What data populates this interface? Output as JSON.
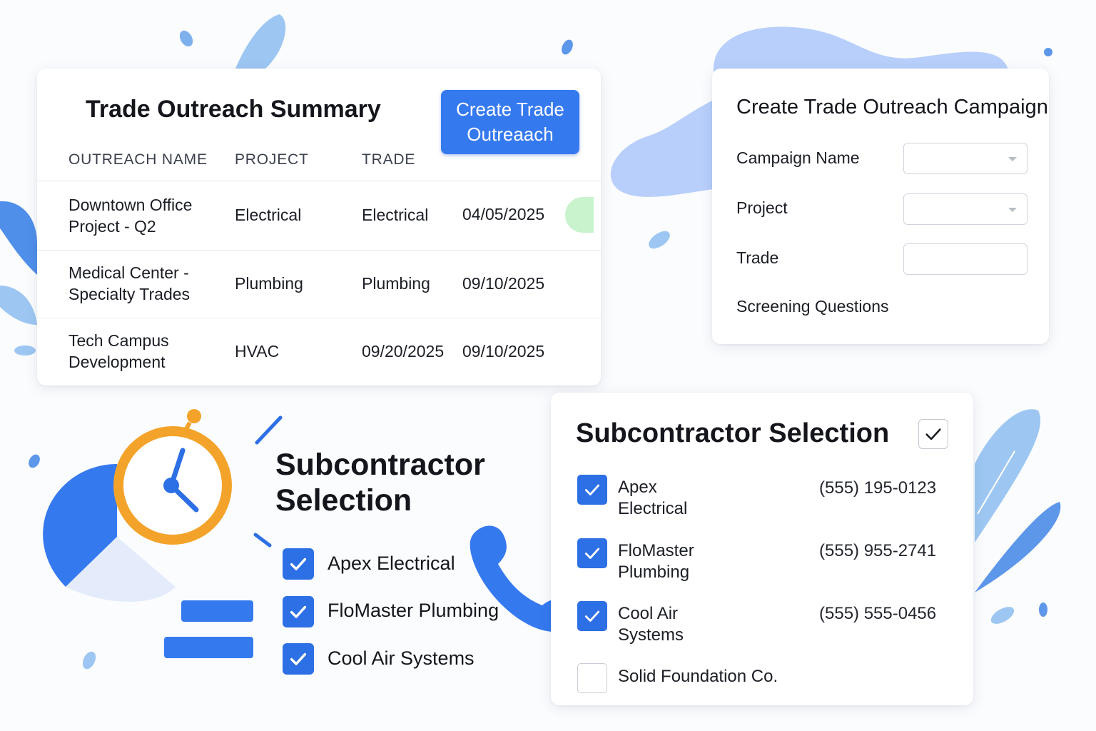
{
  "summary": {
    "title": "Trade Outreach Summary",
    "create_button": "Create Trade Outreaach",
    "columns": [
      "OUTREACH NAME",
      "PROJECT",
      "TRADE"
    ],
    "rows": [
      {
        "name": "Downtown Office Project - Q2",
        "project": "Electrical",
        "trade": "Electrical",
        "date": "04/05/2025",
        "status_color": "#c9f3cd"
      },
      {
        "name": "Medical Center - Specialty Trades",
        "project": "Plumbing",
        "trade": "Plumbing",
        "date": "09/10/2025"
      },
      {
        "name": "Tech Campus Development",
        "project": "HVAC",
        "trade": "09/20/2025",
        "date": "09/10/2025"
      }
    ]
  },
  "campaign": {
    "title": "Create Trade Outreach Campaign",
    "fields": [
      {
        "label": "Campaign Name",
        "type": "select",
        "value": ""
      },
      {
        "label": "Project",
        "type": "select",
        "value": ""
      },
      {
        "label": "Trade",
        "type": "text",
        "value": ""
      }
    ],
    "screening_label": "Screening Questions"
  },
  "illustration": {
    "title": "Subcontractor Selection",
    "items": [
      {
        "label": "Apex Electrical",
        "checked": true
      },
      {
        "label": "FloMaster Plumbing",
        "checked": true
      },
      {
        "label": "Cool Air Systems",
        "checked": true
      }
    ]
  },
  "subcontractors": {
    "title": "Subcontractor Selection",
    "select_all_checked": true,
    "items": [
      {
        "name": "Apex Electrical",
        "phone": "(555) 195-0123",
        "checked": true
      },
      {
        "name": "FloMaster Plumbing",
        "phone": "(555) 955-2741",
        "checked": true
      },
      {
        "name": "Cool Air Systems",
        "phone": "(555) 555-0456",
        "checked": true
      },
      {
        "name": "Solid Foundation Co.",
        "phone": "",
        "checked": false
      }
    ]
  },
  "colors": {
    "accent": "#3579ef",
    "checkbox": "#2d6fe4",
    "clock": "#f4a32a",
    "status_green": "#c9f3cd"
  },
  "icons": [
    "clock-icon",
    "pie-chart-icon",
    "phone-icon",
    "check-icon",
    "chevron-down-icon"
  ]
}
